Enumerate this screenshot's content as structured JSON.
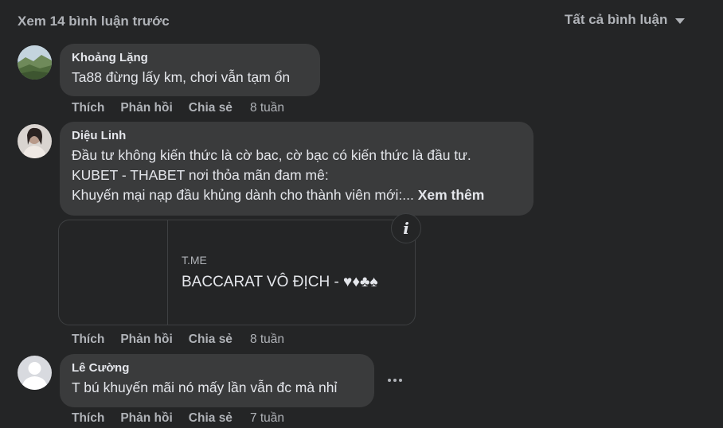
{
  "header": {
    "view_previous": "Xem 14 bình luận trước",
    "sort_label": "Tất cả bình luận",
    "sort_icon": "caret-down-icon"
  },
  "comments": [
    {
      "author": "Khoảng Lặng",
      "text_lines": [
        "Ta88 đừng lấy km, chơi vẫn tạm ổn"
      ],
      "actions": {
        "like": "Thích",
        "reply": "Phản hồi",
        "share": "Chia sẻ"
      },
      "time": "8 tuần"
    },
    {
      "author": "Diệu Linh",
      "text_lines": [
        "Đầu tư không kiến thức là cờ bac, cờ bạc có kiến thức là đầu tư.",
        "KUBET - THABET nơi thỏa mãn đam mê:",
        "Khuyến mại nạp đầu khủng dành cho thành viên mới:..."
      ],
      "see_more": "Xem thêm",
      "link_preview": {
        "domain": "T.ME",
        "title": "BACCARAT VÔ ĐỊCH - ♥♦♣♠",
        "info_icon": "info-icon"
      },
      "actions": {
        "like": "Thích",
        "reply": "Phản hồi",
        "share": "Chia sẻ"
      },
      "time": "8 tuần"
    },
    {
      "author": "Lê Cường",
      "text_lines": [
        "T bú khuyến mãi nó mấy lần vẫn đc mà nhỉ"
      ],
      "more_icon": "more-options-icon",
      "actions": {
        "like": "Thích",
        "reply": "Phản hồi",
        "share": "Chia sẻ"
      },
      "time": "7 tuần"
    }
  ]
}
